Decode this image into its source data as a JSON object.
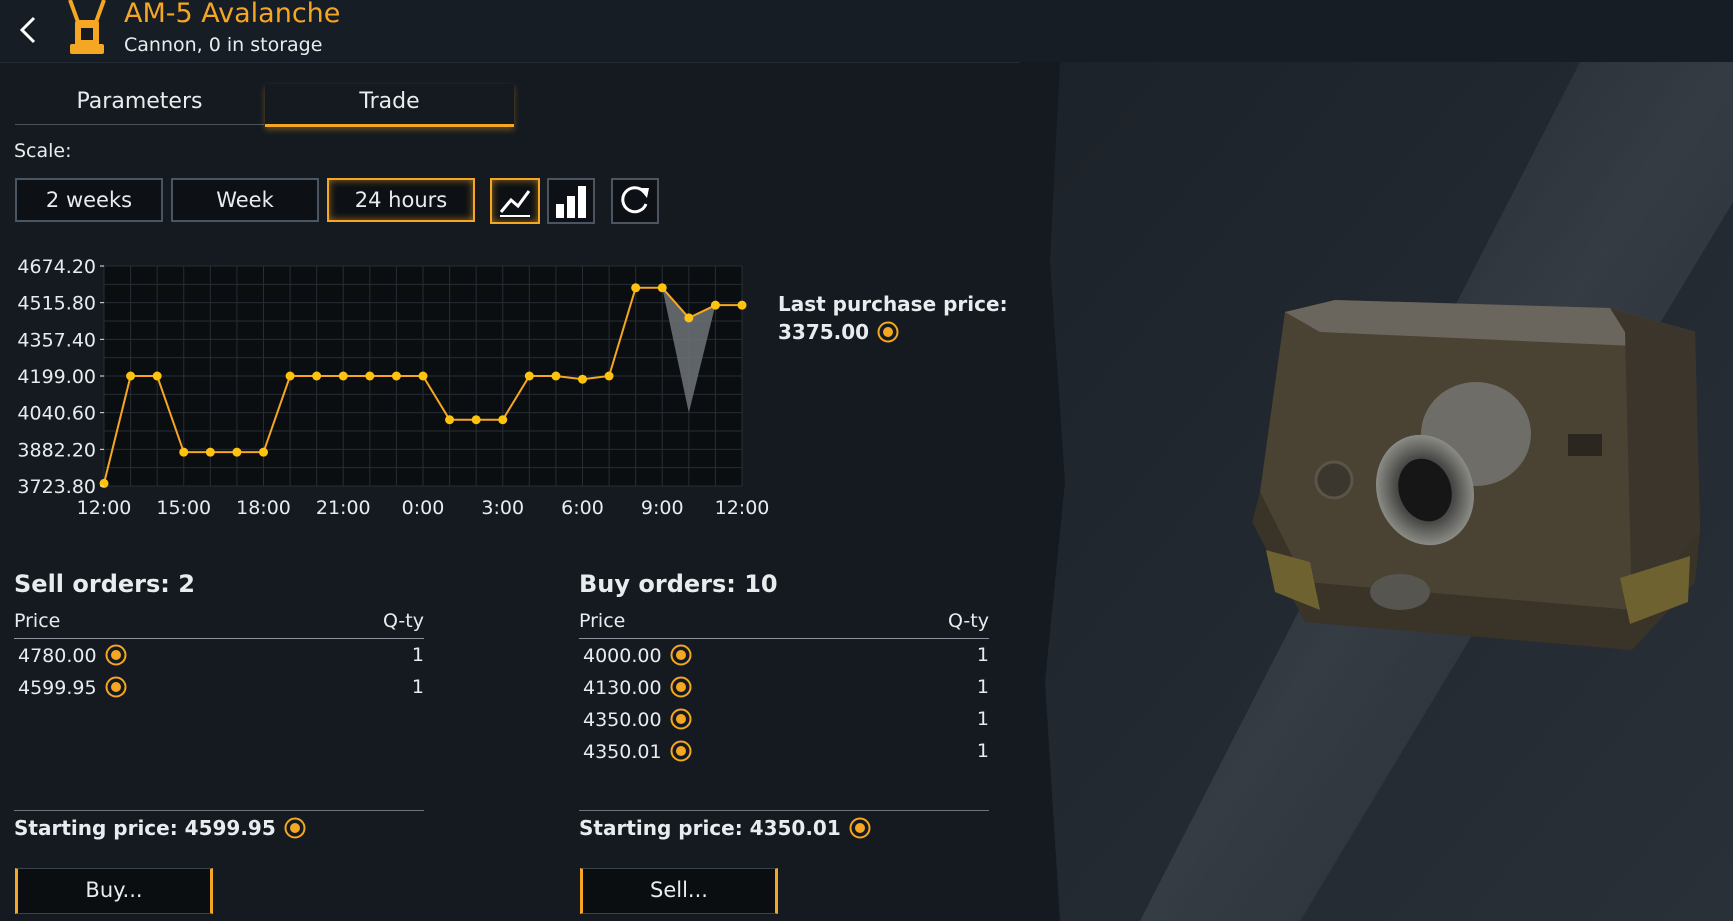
{
  "header": {
    "title": "AM-5 Avalanche",
    "subtitle": "Cannon, 0 in storage"
  },
  "tabs": [
    {
      "label": "Parameters",
      "active": false
    },
    {
      "label": "Trade",
      "active": true
    }
  ],
  "scale": {
    "label": "Scale:",
    "options": [
      "2 weeks",
      "Week",
      "24 hours"
    ],
    "selected": "24 hours",
    "chart_mode": "line"
  },
  "chart_data": {
    "type": "line",
    "x": [
      "12:00",
      "13:00",
      "14:00",
      "15:00",
      "16:00",
      "17:00",
      "18:00",
      "19:00",
      "20:00",
      "21:00",
      "22:00",
      "23:00",
      "0:00",
      "1:00",
      "2:00",
      "3:00",
      "4:00",
      "5:00",
      "6:00",
      "7:00",
      "8:00",
      "9:00",
      "10:00",
      "11:00",
      "12:00"
    ],
    "values": [
      3735,
      4199,
      4199,
      3870,
      3870,
      3870,
      3870,
      4199,
      4199,
      4199,
      4199,
      4199,
      4199,
      4010,
      4010,
      4010,
      4199,
      4199,
      4185,
      4199,
      4580,
      4580,
      4450,
      4505,
      4505
    ],
    "range_low": {
      "index": 22,
      "value": 4040
    },
    "x_ticks": [
      "12:00",
      "15:00",
      "18:00",
      "21:00",
      "0:00",
      "3:00",
      "6:00",
      "9:00",
      "12:00"
    ],
    "y_ticks": [
      "4674.20",
      "4515.80",
      "4357.40",
      "4199.00",
      "4040.60",
      "3882.20",
      "3723.80"
    ],
    "ylim": [
      3723.8,
      4674.2
    ],
    "grid": true,
    "line_color": "#f5a623",
    "point_color": "#ffc20e"
  },
  "last_purchase": {
    "label": "Last purchase price:",
    "value": "3375.00"
  },
  "sell_orders": {
    "title": "Sell orders: 2",
    "col_price": "Price",
    "col_qty": "Q-ty",
    "rows": [
      {
        "price": "4780.00",
        "qty": "1"
      },
      {
        "price": "4599.95",
        "qty": "1"
      }
    ],
    "starting_price": "Starting price: 4599.95",
    "button": "Buy..."
  },
  "buy_orders": {
    "title": "Buy orders: 10",
    "col_price": "Price",
    "col_qty": "Q-ty",
    "rows": [
      {
        "price": "4000.00",
        "qty": "1"
      },
      {
        "price": "4130.00",
        "qty": "1"
      },
      {
        "price": "4350.00",
        "qty": "1"
      },
      {
        "price": "4350.01",
        "qty": "1"
      }
    ],
    "starting_price": "Starting price: 4350.01",
    "button": "Sell..."
  },
  "colors": {
    "accent": "#f5a623",
    "background": "#141a20"
  },
  "icons": {
    "back": "chevron-left-icon",
    "item": "cannon-icon",
    "currency": "coin-icon",
    "line_chart": "line-chart-icon",
    "bar_chart": "bar-chart-icon",
    "refresh": "refresh-icon"
  }
}
